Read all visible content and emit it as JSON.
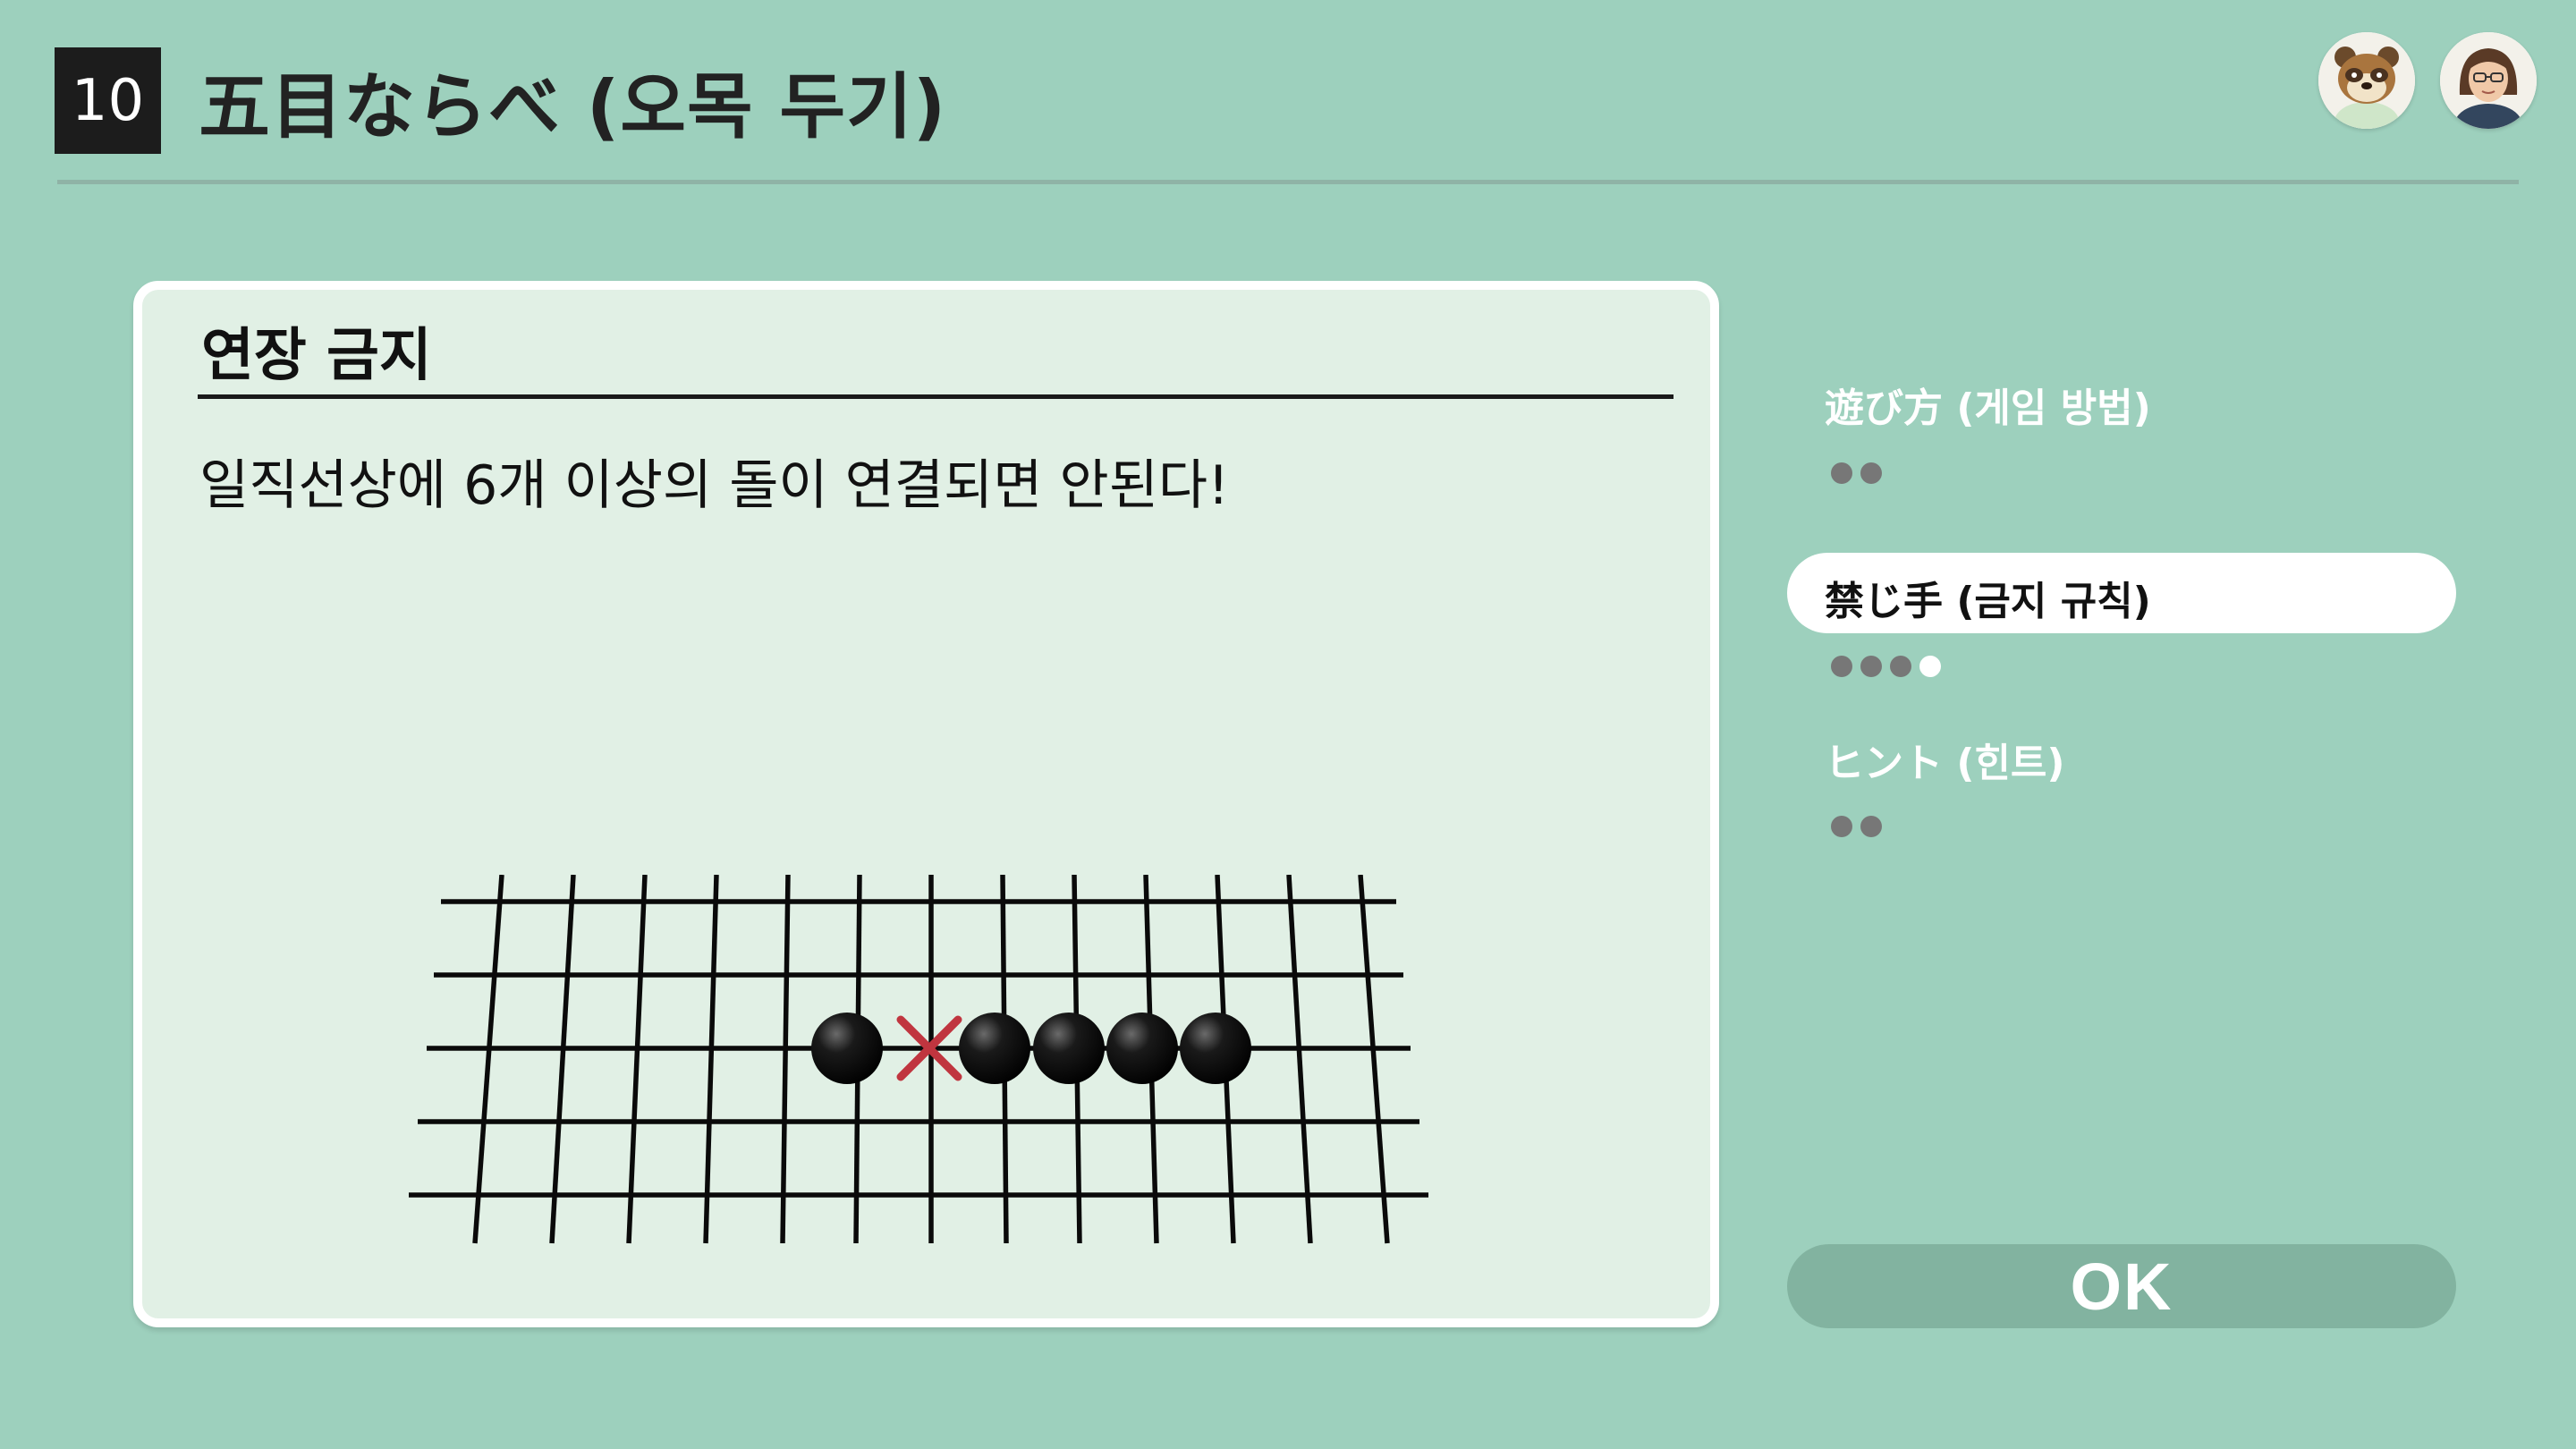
{
  "header": {
    "number": "10",
    "title": "五目ならべ (오목 두기)"
  },
  "panel": {
    "title": "연장 금지",
    "description": "일직선상에 6개 이상의 돌이 연결되면 안된다!"
  },
  "menu": {
    "items": [
      {
        "label": "遊び方 (게임 방법)",
        "dots": 2,
        "current_dot": null,
        "selected": false
      },
      {
        "label": "禁じ手 (금지 규칙)",
        "dots": 4,
        "current_dot": 4,
        "selected": true
      },
      {
        "label": "ヒント (힌트)",
        "dots": 2,
        "current_dot": null,
        "selected": false
      }
    ]
  },
  "ok_button": {
    "label": "OK"
  },
  "colors": {
    "background": "#9dd0bd",
    "panel": "#e1f0e5",
    "stone": "#111111",
    "forbidden_mark": "#c0353f"
  },
  "icons": {
    "avatar_1": "raccoon-character-avatar",
    "avatar_2": "user-mii-avatar",
    "forbidden": "x-mark-icon"
  }
}
